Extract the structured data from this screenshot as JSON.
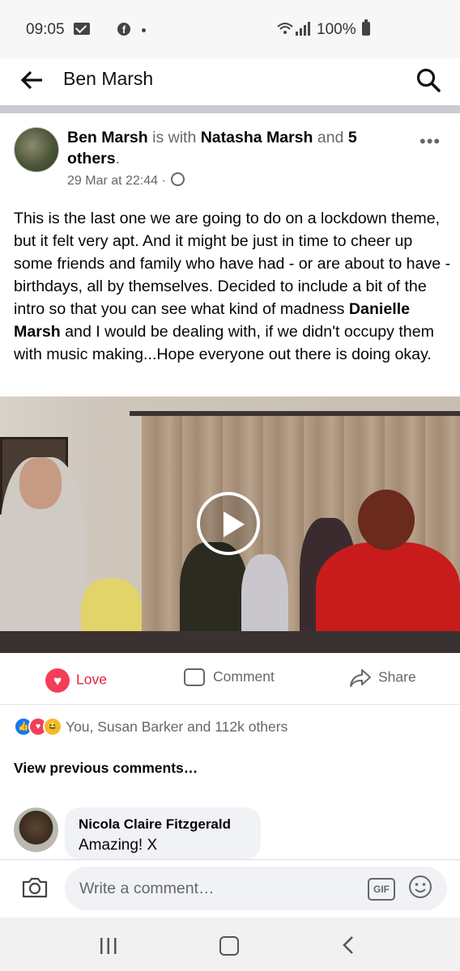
{
  "status_bar": {
    "time": "09:05",
    "battery": "100%",
    "icons": [
      "mail-icon",
      "facebook-icon",
      "dot-icon",
      "wifi-icon",
      "signal-icon",
      "battery-icon"
    ]
  },
  "header": {
    "title": "Ben Marsh",
    "back_icon": "back-arrow-icon",
    "search_icon": "search-icon"
  },
  "post": {
    "author": "Ben Marsh",
    "with_text": " is with ",
    "tagged": "Natasha Marsh",
    "and_text": " and ",
    "others": "5 others",
    "period": ".",
    "timestamp": "29 Mar at 22:44",
    "meta_sep": " · ",
    "privacy_icon": "globe-icon",
    "more_icon": "more-icon",
    "body_before": "This is the last one we are going to do on a lockdown theme, but it felt very apt. And it might be just in time to cheer up some friends and family who have had - or are about to have -  birthdays, all by themselves. Decided to include a bit of the intro so that you can see what kind of madness ",
    "body_tag": "Danielle Marsh",
    "body_after": " and I would be dealing with, if we didn't occupy them with music making...Hope everyone out there is doing okay."
  },
  "actions": {
    "love": "Love",
    "comment": "Comment",
    "share": "Share"
  },
  "reactions": {
    "summary": "You, Susan Barker and 112k others",
    "icons": [
      "like-icon",
      "love-icon",
      "haha-icon"
    ]
  },
  "comments": {
    "view_previous": "View previous comments…",
    "items": [
      {
        "name": "Nicola Claire Fitzgerald",
        "text": "Amazing! X"
      }
    ]
  },
  "composer": {
    "placeholder": "Write a comment…",
    "gif": "GIF"
  },
  "colors": {
    "love_red": "#e41e3f",
    "facebook_blue": "#1877f2",
    "secondary_text": "#65676b"
  }
}
